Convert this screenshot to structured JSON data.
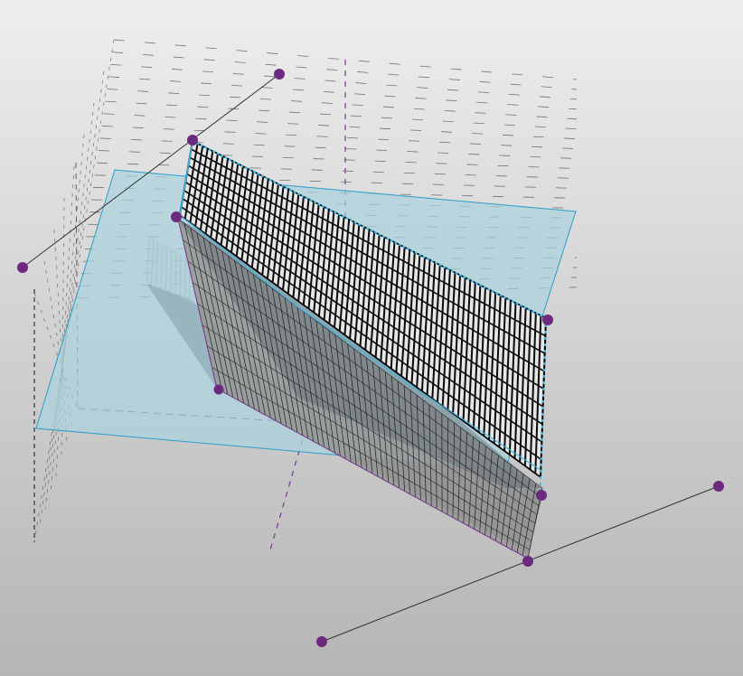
{
  "colors": {
    "background_top": "#eeeeee",
    "background_bottom": "#b5b5b5",
    "grid_line": "#555555",
    "axis_purple": "#7a3b8f",
    "handle_purple": "#6b2a7f",
    "workplane_fill": "#a9d3df",
    "workplane_edge": "#2a9cc8",
    "surface_stripe_light": "#e6e6e6",
    "surface_stripe_dark": "#0a0a0a",
    "surface_grey": "#9a9a9a",
    "surface_grey_dark": "#5e6a70",
    "selection_cyan": "#39b6e6",
    "manipulator_line": "#333333"
  },
  "icons": {
    "control_handle": "purple-dot",
    "manipulator_arm": "thin-line"
  }
}
